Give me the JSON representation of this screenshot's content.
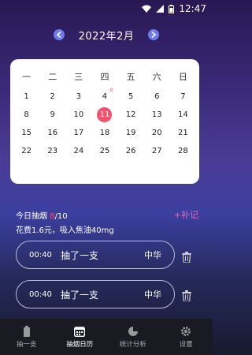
{
  "status": {
    "time": "12:47"
  },
  "header": {
    "month": "2022年2月"
  },
  "calendar": {
    "weekdays": [
      "一",
      "二",
      "三",
      "四",
      "五",
      "六",
      "日"
    ],
    "days": [
      "1",
      "2",
      "3",
      "4",
      "5",
      "6",
      "7",
      "8",
      "9",
      "10",
      "11",
      "12",
      "13",
      "14",
      "15",
      "16",
      "17",
      "18",
      "19",
      "20",
      "21",
      "22",
      "23",
      "24",
      "25",
      "26",
      "27",
      "28"
    ],
    "selected": "11",
    "marked": "4",
    "mark_text": "8"
  },
  "summary": {
    "prefix": "今日抽烟 ",
    "count": "8",
    "total": "/10"
  },
  "cost_text": "花费1.6元，吸入焦油40mg",
  "add_record": "+补记",
  "records": [
    {
      "time": "00:40",
      "action": "抽了一支",
      "brand": "中华"
    },
    {
      "time": "00:40",
      "action": "抽了一支",
      "brand": "中华"
    }
  ],
  "tabs": [
    {
      "label": "抽一支",
      "icon": "cigarette-icon"
    },
    {
      "label": "抽烟日历",
      "icon": "calendar-icon",
      "active": true
    },
    {
      "label": "统计分析",
      "icon": "pie-chart-icon"
    },
    {
      "label": "设置",
      "icon": "gear-icon"
    }
  ],
  "colors": {
    "accent": "#f2506c",
    "add": "#e56fc0",
    "nav": "#6d7af0"
  }
}
